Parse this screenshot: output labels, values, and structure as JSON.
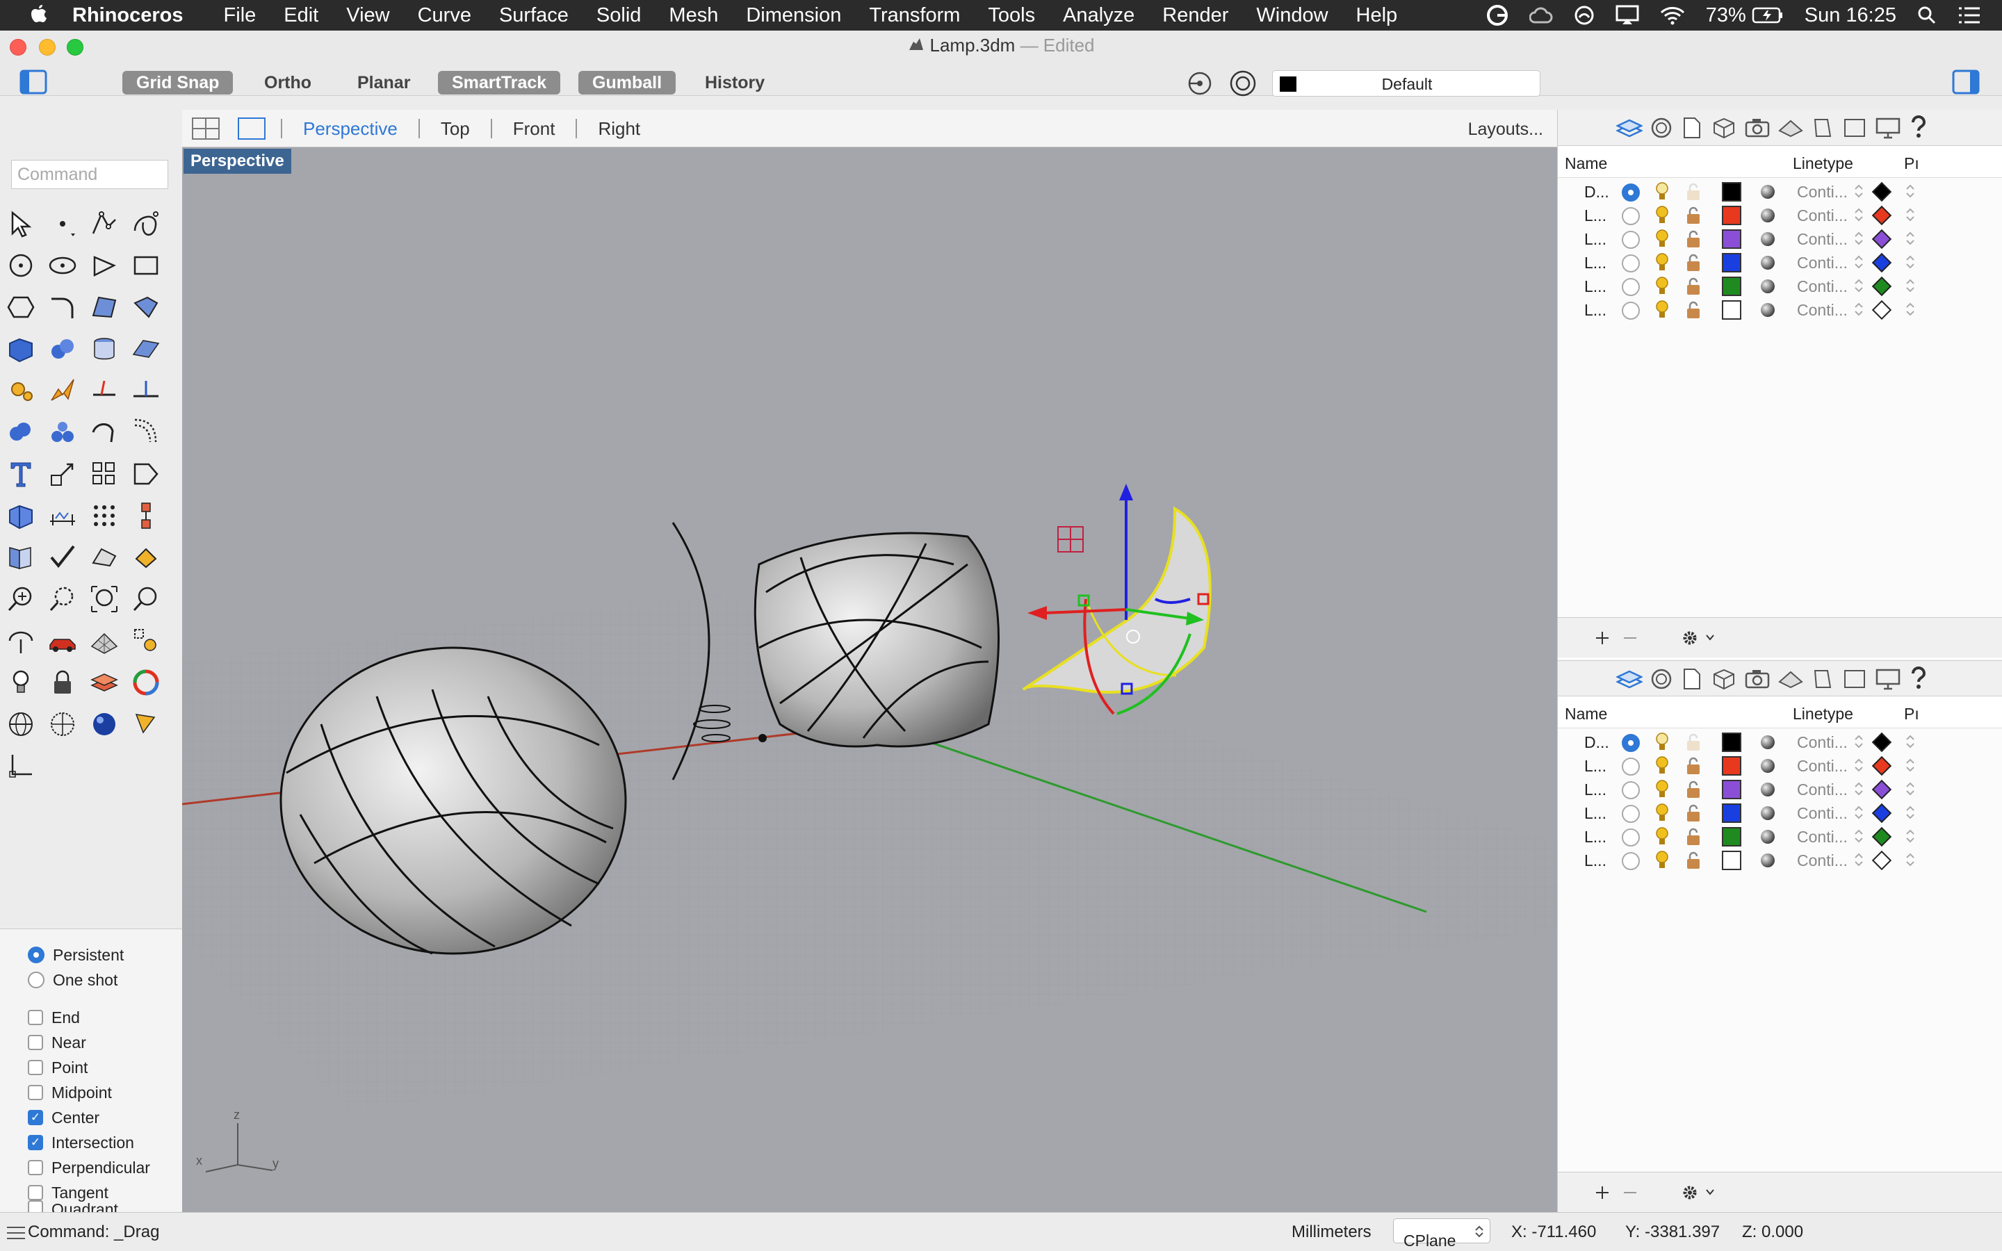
{
  "menubar": {
    "app": "Rhinoceros",
    "items": [
      "File",
      "Edit",
      "View",
      "Curve",
      "Surface",
      "Solid",
      "Mesh",
      "Dimension",
      "Transform",
      "Tools",
      "Analyze",
      "Render",
      "Window",
      "Help"
    ],
    "battery": "73%",
    "clock": "Sun 16:25"
  },
  "window": {
    "filename": "Lamp.3dm",
    "state": "— Edited"
  },
  "toolbar": {
    "toggles": [
      {
        "label": "Grid Snap",
        "on": true
      },
      {
        "label": "Ortho",
        "on": false
      },
      {
        "label": "Planar",
        "on": false
      },
      {
        "label": "SmartTrack",
        "on": true
      },
      {
        "label": "Gumball",
        "on": true
      },
      {
        "label": "History",
        "on": false
      }
    ],
    "layer": "Default"
  },
  "viewtabs": {
    "tabs": [
      "Perspective",
      "Top",
      "Front",
      "Right"
    ],
    "active": "Perspective",
    "layouts": "Layouts..."
  },
  "command": {
    "placeholder": "Command",
    "status": "Command: _Drag"
  },
  "viewport": {
    "label": "Perspective",
    "axis_labels": {
      "z": "z",
      "x": "x",
      "y": "y"
    }
  },
  "osnap": {
    "mode_options": [
      {
        "label": "Persistent",
        "selected": true
      },
      {
        "label": "One shot",
        "selected": false
      }
    ],
    "snaps": [
      {
        "label": "End",
        "checked": false
      },
      {
        "label": "Near",
        "checked": false
      },
      {
        "label": "Point",
        "checked": false
      },
      {
        "label": "Midpoint",
        "checked": false
      },
      {
        "label": "Center",
        "checked": true
      },
      {
        "label": "Intersection",
        "checked": true
      },
      {
        "label": "Perpendicular",
        "checked": false
      },
      {
        "label": "Tangent",
        "checked": false
      },
      {
        "label": "Quadrant",
        "checked": false
      }
    ]
  },
  "layers": {
    "columns": {
      "name": "Name",
      "linetype": "Linetype",
      "print": "Pı"
    },
    "rows": [
      {
        "name": "D...",
        "current": true,
        "color": "#000000",
        "linetype": "Conti...",
        "print_color": "#000000"
      },
      {
        "name": "L...",
        "current": false,
        "color": "#e8391f",
        "linetype": "Conti...",
        "print_color": "#e8391f"
      },
      {
        "name": "L...",
        "current": false,
        "color": "#8a4fd6",
        "linetype": "Conti...",
        "print_color": "#8a4fd6"
      },
      {
        "name": "L...",
        "current": false,
        "color": "#1a3fe0",
        "linetype": "Conti...",
        "print_color": "#1a3fe0"
      },
      {
        "name": "L...",
        "current": false,
        "color": "#1f8a1f",
        "linetype": "Conti...",
        "print_color": "#1f8a1f"
      },
      {
        "name": "L...",
        "current": false,
        "color": "#ffffff",
        "linetype": "Conti...",
        "print_color": "#ffffff"
      }
    ]
  },
  "status": {
    "units": "Millimeters",
    "cplane": "CPlane",
    "x": "X: -711.460",
    "y": "Y: -3381.397",
    "z": "Z: 0.000"
  },
  "colors": {
    "accent": "#2e78d6",
    "viewport_bg": "#a4a6ab",
    "menubar": "#2b2b2b"
  }
}
